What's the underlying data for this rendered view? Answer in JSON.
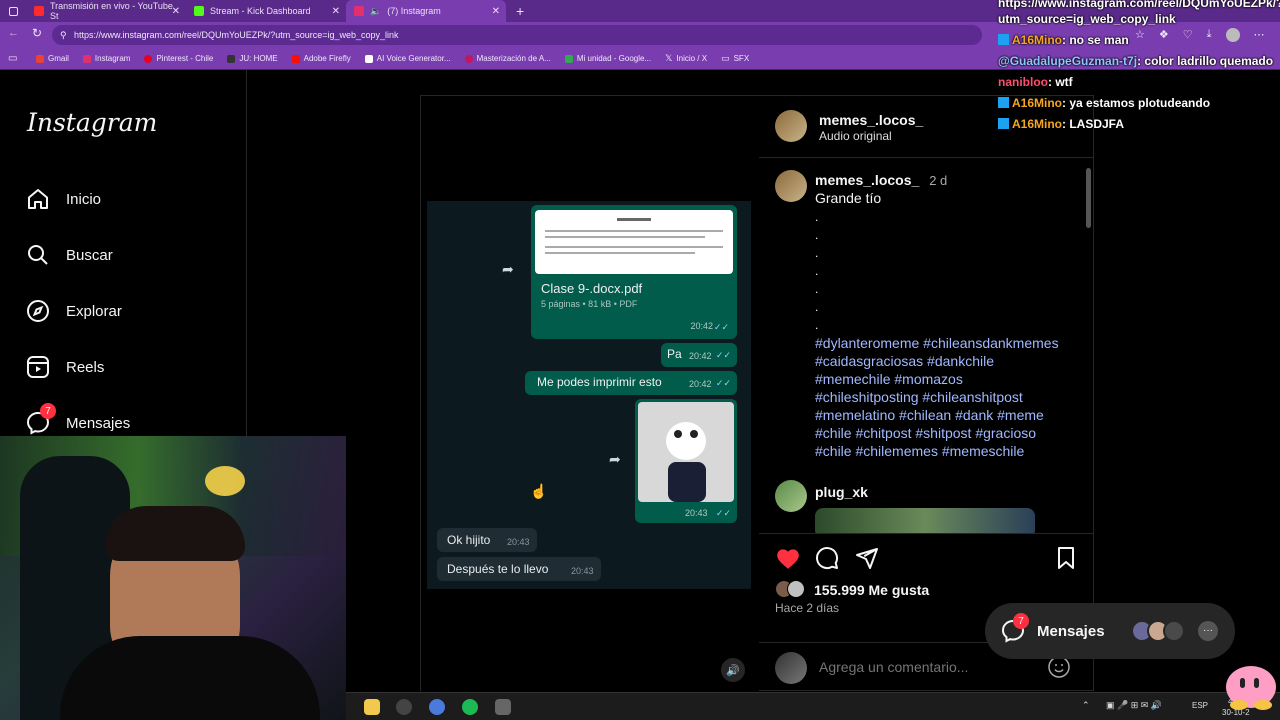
{
  "browser": {
    "tabs": [
      {
        "title": "Transmisión en vivo - YouTube St",
        "color": "#ff2a2a"
      },
      {
        "title": "Stream - Kick Dashboard",
        "color": "#53fc18"
      },
      {
        "title": "(7) Instagram",
        "color": "#e1306c"
      }
    ],
    "new_tab": "+",
    "url": "https://www.instagram.com/reel/DQUmYoUEZPk/?utm_source=ig_web_copy_link",
    "bookmarks": [
      "Gmail",
      "Instagram",
      "Pinterest - Chile",
      "JU: HOME",
      "Adobe Firefly",
      "AI Voice Generator...",
      "Masterización de A...",
      "Mi unidad - Google...",
      "Inicio / X",
      "SFX"
    ]
  },
  "sidebar": {
    "logo": "Instagram",
    "items": [
      {
        "label": "Inicio",
        "icon": "home-icon"
      },
      {
        "label": "Buscar",
        "icon": "search-icon"
      },
      {
        "label": "Explorar",
        "icon": "compass-icon"
      },
      {
        "label": "Reels",
        "icon": "reels-icon"
      },
      {
        "label": "Mensajes",
        "icon": "messenger-icon",
        "badge": "7"
      }
    ]
  },
  "post": {
    "author": "memes_.locos_",
    "audio": "Audio original",
    "chat_screenshot": {
      "doc_name": "Clase 9-.docx.pdf",
      "doc_meta": "5 páginas • 81 kB • PDF",
      "doc_time": "20:42",
      "msg1": "Pa",
      "msg1_time": "20:42",
      "msg2": "Me podes imprimir esto",
      "msg2_time": "20:42",
      "img_time": "20:43",
      "reply1": "Ok hijito",
      "reply1_time": "20:43",
      "reply2": "Después te lo llevo",
      "reply2_time": "20:43"
    },
    "caption_user": "memes_.locos_",
    "caption_age": "2 d",
    "caption_text": "Grande tío",
    "dots": [
      ".",
      ".",
      ".",
      ".",
      ".",
      ".",
      "."
    ],
    "hashtag_lines": [
      "#dylanteromeme #chileansdankmemes",
      "#caidasgraciosas #dankchile",
      "#memechile #momazos",
      "#chileshitposting #chileanshitpost",
      "#memelatino #chilean #dank #meme",
      "#chile #chitpost #shitpost #gracioso",
      "#chile #chilememes #memeschile"
    ],
    "comment_user": "plug_xk",
    "likes": "155.999 Me gusta",
    "age": "Hace 2 días",
    "comment_placeholder": "Agrega un comentario..."
  },
  "messages_pill": {
    "label": "Mensajes",
    "badge": "7",
    "more": "···"
  },
  "stream_chat": [
    {
      "user": "https://www.instagram.com/reel/DQUmYoUEZPk/?",
      "text": "",
      "color": "#ffffff"
    },
    {
      "user": "utm_source=ig_web_copy_link",
      "text": "",
      "color": "#ffffff"
    },
    {
      "user": "A16Mino",
      "text": ": no se man",
      "color": "#f5a623"
    },
    {
      "user": "@GuadalupeGuzman-t7j",
      "text": ": color ladrillo quemado",
      "color": "#8ec5ff"
    },
    {
      "user": "nanibloo",
      "text": ": wtf",
      "color": "#ff4d6d"
    },
    {
      "user": "A16Mino",
      "text": ": ya estamos plotudeando",
      "color": "#f5a623"
    },
    {
      "user": "A16Mino",
      "text": ": LASDJFA",
      "color": "#f5a623"
    }
  ],
  "taskbar": {
    "lang": "ESP",
    "time": "4:30",
    "date": "30-10-2"
  }
}
